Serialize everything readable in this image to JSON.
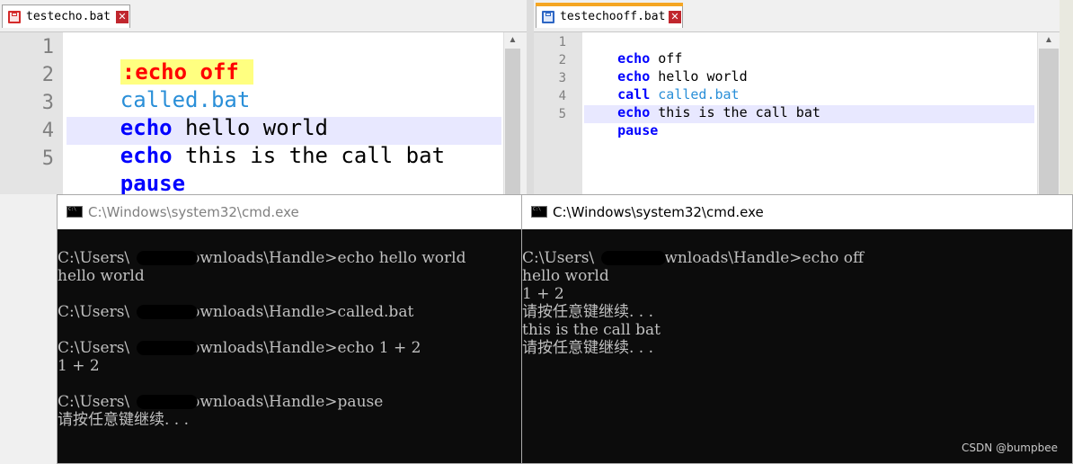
{
  "left_editor": {
    "tab_title": "testecho.bat",
    "tab_close": "✕",
    "line_numbers": [
      "1",
      "2",
      "3",
      "4",
      "5"
    ],
    "lines": {
      "l1": ":echo off",
      "l2": "called.bat",
      "l3_kw": "echo",
      "l3_text": " hello world",
      "l4_kw": "echo",
      "l4_text": " this is the call bat",
      "l5_kw": "pause"
    },
    "scroll_up": "▲"
  },
  "right_editor": {
    "tab_title": "testechooff.bat",
    "tab_close": "✕",
    "line_numbers": [
      "1",
      "2",
      "3",
      "4",
      "5"
    ],
    "lines": {
      "l1_kw": "echo",
      "l1_text": " off",
      "l2_kw": "echo",
      "l2_text": " hello world",
      "l3_kw": "call",
      "l3_text": "called.bat",
      "l4_kw": "echo",
      "l4_text": " this is the call bat",
      "l5_kw": "pause"
    },
    "scroll_up": "▲"
  },
  "left_cmd": {
    "title": "C:\\Windows\\system32\\cmd.exe",
    "lines": [
      "C:\\Users\\         \\Downloads\\Handle>echo hello world",
      "hello world",
      "",
      "C:\\Users\\         \\Downloads\\Handle>called.bat",
      "",
      "C:\\Users\\         \\Downloads\\Handle>echo 1 + 2",
      "1 + 2",
      "",
      "C:\\Users\\         \\Downloads\\Handle>pause",
      "请按任意键继续. . ."
    ]
  },
  "right_cmd": {
    "title": "C:\\Windows\\system32\\cmd.exe",
    "lines": [
      "C:\\Users\\         \\Downloads\\Handle>echo off",
      "hello world",
      "1 + 2",
      "请按任意键继续. . .",
      "this is the call bat",
      "请按任意键继续. . ."
    ]
  },
  "watermark": "CSDN @bumpbee",
  "colors": {
    "keyword": "#0000ff",
    "label_red": "#ff0000",
    "label_bg": "#ffff80",
    "call_target": "#2a8fd8",
    "terminal_bg": "#0c0c0c",
    "terminal_text": "#c0c0c0",
    "tab_accent": "#f5a623"
  }
}
